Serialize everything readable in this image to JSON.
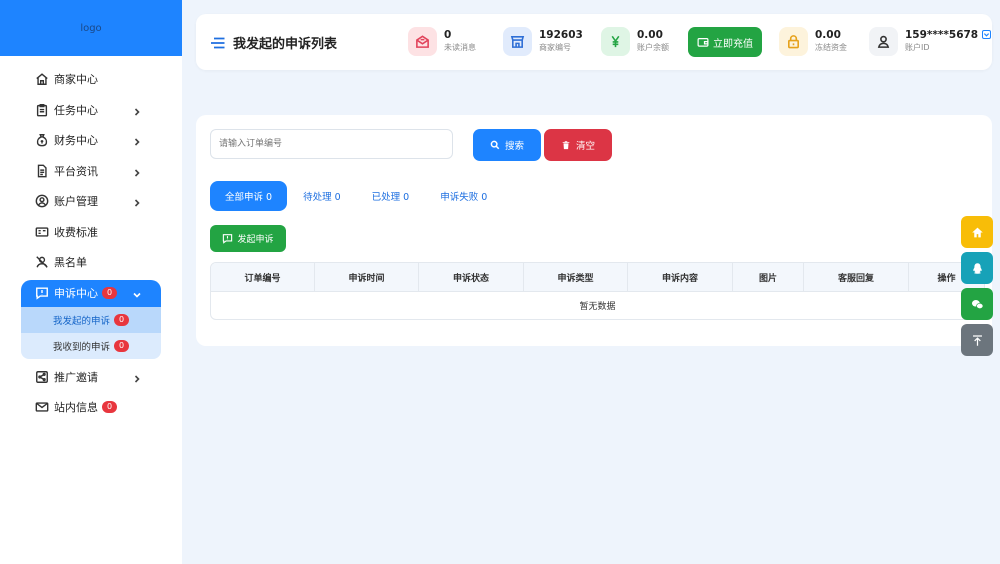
{
  "sidebar": {
    "logo": "logo",
    "items": [
      {
        "label": "商家中心",
        "icon": "home-icon"
      },
      {
        "label": "任务中心",
        "icon": "clipboard-icon"
      },
      {
        "label": "财务中心",
        "icon": "money-bag-icon"
      },
      {
        "label": "平台资讯",
        "icon": "document-icon"
      },
      {
        "label": "账户管理",
        "icon": "user-circle-icon"
      },
      {
        "label": "收费标准",
        "icon": "ticket-icon"
      },
      {
        "label": "黑名单",
        "icon": "user-slash-icon"
      },
      {
        "label": "申诉中心",
        "icon": "alert-message-icon",
        "badge": "0"
      },
      {
        "label": "推广邀请",
        "icon": "share-icon"
      },
      {
        "label": "站内信息",
        "icon": "envelope-icon",
        "badge": "0"
      }
    ],
    "submenu": [
      {
        "label": "我发起的申诉",
        "badge": "0"
      },
      {
        "label": "我收到的申诉",
        "badge": "0"
      }
    ]
  },
  "header": {
    "title": "我发起的申诉列表",
    "stats": [
      {
        "value": "0",
        "label": "未读消息"
      },
      {
        "value": "192603",
        "label": "商家编号"
      },
      {
        "value": "0.00",
        "label": "账户余额"
      },
      {
        "value": "0.00",
        "label": "冻结资金"
      },
      {
        "value": "159****5678",
        "label": "账户ID"
      }
    ],
    "recharge_label": "立即充值",
    "colors": {
      "primary": "#1e84ff",
      "success": "#23a443",
      "danger": "#dc3545"
    }
  },
  "content": {
    "search_placeholder": "请输入订单编号",
    "search_label": "搜索",
    "clear_label": "清空",
    "tabs": [
      "全部申诉 0",
      "待处理 0",
      "已处理 0",
      "申诉失败 0"
    ],
    "new_label": "发起申诉",
    "columns": [
      "订单编号",
      "申诉时间",
      "申诉状态",
      "申诉类型",
      "申诉内容",
      "图片",
      "客服回复",
      "操作"
    ],
    "empty_text": "暂无数据"
  },
  "float_buttons": [
    "home-icon",
    "qq-icon",
    "wechat-icon",
    "back-to-top-icon"
  ]
}
